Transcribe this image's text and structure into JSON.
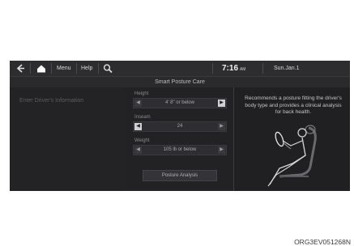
{
  "topbar": {
    "back_icon": "back-arrow-icon",
    "home_icon": "home-icon",
    "menu_label": "Menu",
    "help_label": "Help",
    "search_icon": "search-icon",
    "time": "7:16",
    "ampm": "AM",
    "date": "Sun.Jan.1"
  },
  "title": "Smart Posture Care",
  "left": {
    "driver_info": "Enter Driver's Information"
  },
  "form": {
    "height": {
      "label": "Height",
      "value": "4' 8\" or below"
    },
    "inseam": {
      "label": "Inseam",
      "value": "24"
    },
    "weight": {
      "label": "Weight",
      "value": "105 lb or below"
    },
    "button_label": "Posture Analysis"
  },
  "right": {
    "description": "Recommends a posture fitting the driver's body type and provides a clinical analysis for back health."
  },
  "caption": "ORG3EV051268N"
}
